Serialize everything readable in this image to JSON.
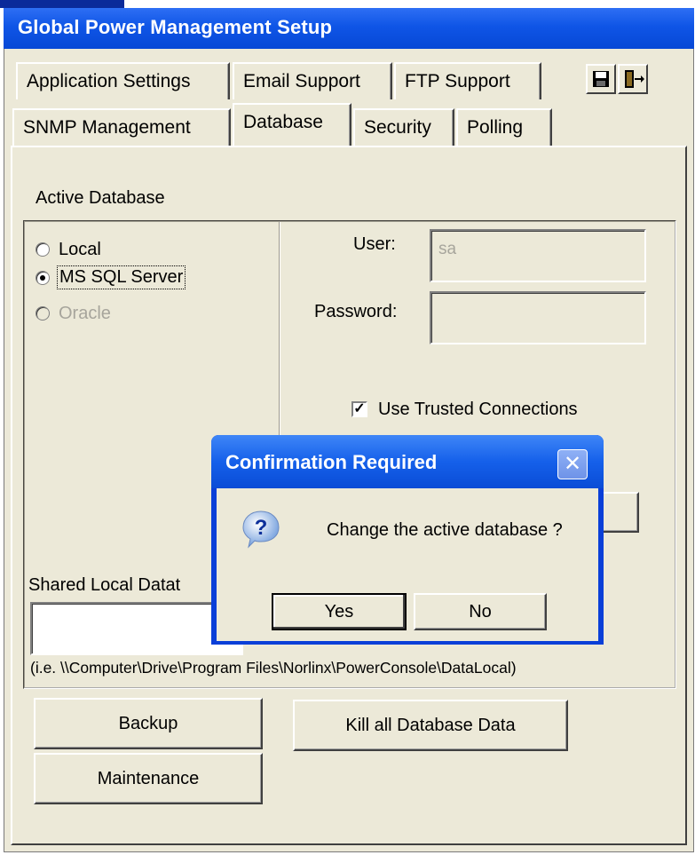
{
  "window": {
    "title": "Global Power Management Setup",
    "title_color": "#0f55e6",
    "save_icon": "floppy-disk-icon",
    "exit_icon": "exit-door-icon"
  },
  "tabs": {
    "row1": [
      "Application Settings",
      "Email Support",
      "FTP Support"
    ],
    "row2": [
      "SNMP Management",
      "Database",
      "Security",
      "Polling"
    ],
    "active": "Database"
  },
  "database": {
    "group_label": "Active Database",
    "options": [
      {
        "label": "Local",
        "checked": false,
        "enabled": true
      },
      {
        "label": "MS SQL Server",
        "checked": true,
        "enabled": true
      },
      {
        "label": "Oracle",
        "checked": false,
        "enabled": false
      }
    ],
    "user_label": "User:",
    "user_value": "sa",
    "password_label": "Password:",
    "password_value": "",
    "trusted_label": "Use Trusted Connections",
    "trusted_checked": true,
    "shared_label": "Shared Local Datat",
    "shared_value": "",
    "shared_hint": "(i.e. \\\\Computer\\Drive\\Program Files\\Norlinx\\PowerConsole\\DataLocal)"
  },
  "buttons": {
    "backup": "Backup",
    "kill": "Kill all Database Data",
    "maintenance": "Maintenance"
  },
  "dialog": {
    "title": "Confirmation Required",
    "message": "Change the active database ?",
    "yes": "Yes",
    "no": "No",
    "icon": "question-icon",
    "close_icon": "close-icon"
  }
}
